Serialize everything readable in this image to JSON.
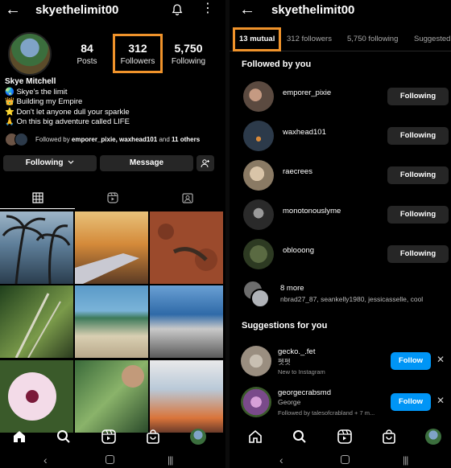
{
  "left": {
    "header": {
      "username": "skyethelimit00"
    },
    "stats": [
      {
        "num": "84",
        "label": "Posts"
      },
      {
        "num": "312",
        "label": "Followers"
      },
      {
        "num": "5,750",
        "label": "Following"
      }
    ],
    "bio": {
      "name": "Skye Mitchell",
      "lines": [
        "🌏 Skye's the limit",
        "👑 Building my Empire",
        "⭐ Don't let anyone dull your sparkle",
        "🙏 On this big adventure called LIFE"
      ]
    },
    "followed_by": {
      "prefix": "Followed by",
      "names": "emporer_pixie, waxhead101",
      "and": "and",
      "others": "11 others"
    },
    "buttons": {
      "following": "Following",
      "message": "Message"
    }
  },
  "right": {
    "header": {
      "username": "skyethelimit00"
    },
    "tabs": [
      "13 mutual",
      "312 followers",
      "5,750 following",
      "Suggested"
    ],
    "followed_by_title": "Followed by you",
    "mutuals": [
      {
        "username": "emporer_pixie",
        "button": "Following",
        "color": "#5b4a40"
      },
      {
        "username": "waxhead101",
        "button": "Following",
        "color": "#2c3a4a"
      },
      {
        "username": "raecrees",
        "button": "Following",
        "color": "#8a7a64"
      },
      {
        "username": "monotonouslyme",
        "button": "Following",
        "color": "#3a3a3a"
      },
      {
        "username": "oblooong",
        "button": "Following",
        "color": "#3d4a32"
      }
    ],
    "more": {
      "count": "8 more",
      "names": "nbrad27_87, seankelly1980, jessicasselle, cool"
    },
    "suggestions_title": "Suggestions for you",
    "suggestions": [
      {
        "username": "gecko._.fet",
        "sub": "펫펫",
        "sub2": "New to Instagram",
        "button": "Follow",
        "color": "#9a8e80"
      },
      {
        "username": "georgecrabsmd",
        "sub": "George",
        "sub2": "Followed by talesofcrabland + 7 m...",
        "button": "Follow",
        "color": "#7a4a8a"
      }
    ]
  }
}
